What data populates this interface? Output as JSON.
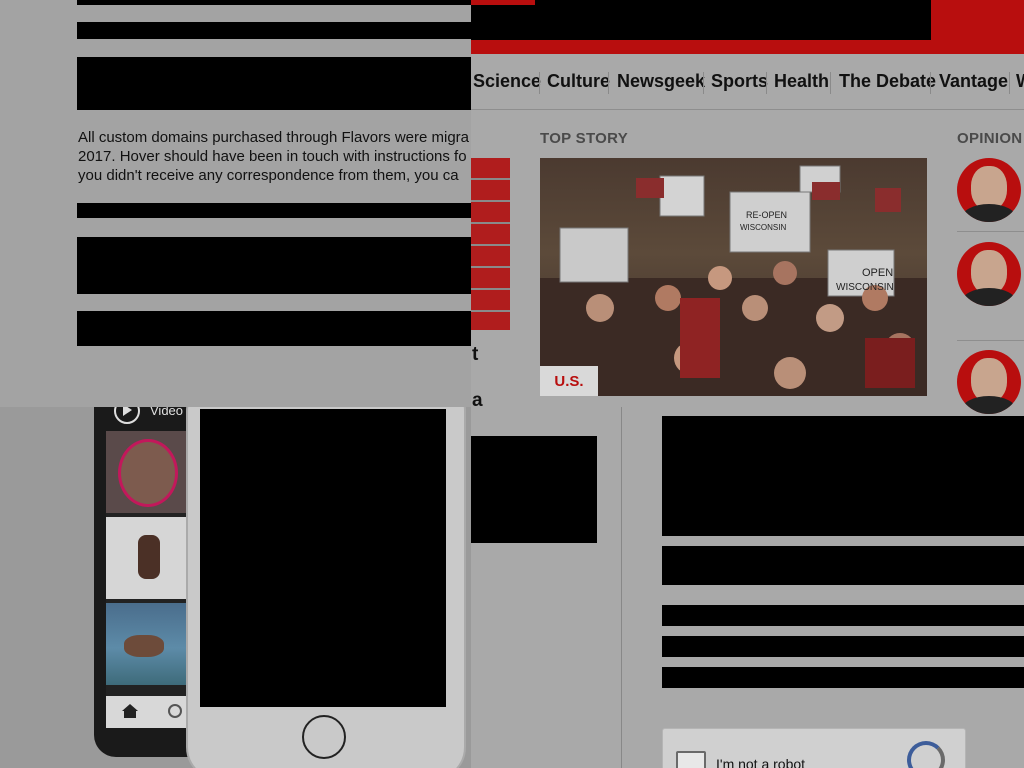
{
  "colors": {
    "brand_red": "#b80e0e",
    "overlay_gray": "#9a9a9a",
    "black_block": "#000000"
  },
  "modal": {
    "message_lines": [
      "All custom domains purchased through Flavors were migra",
      "2017. Hover should have been in touch with instructions fo",
      "you didn't receive any correspondence from them, you ca"
    ]
  },
  "news": {
    "nav": [
      "Science",
      "Culture",
      "Newsgeek",
      "Sports",
      "Health",
      "The Debate",
      "Vantage",
      "W"
    ],
    "top_story_label": "TOP STORY",
    "opinion_label": "OPINION",
    "photo_tag": "U.S.",
    "photo_signs": [
      "OPEN WISCONSIN",
      "RE-OPEN WISCONSIN"
    ],
    "text_fragments": [
      "t",
      "a"
    ]
  },
  "phones": {
    "video_label": "Video",
    "icons": [
      "play-icon",
      "home-icon",
      "search-icon",
      "home-button"
    ]
  },
  "captcha": {
    "label": "I'm not a robot"
  }
}
